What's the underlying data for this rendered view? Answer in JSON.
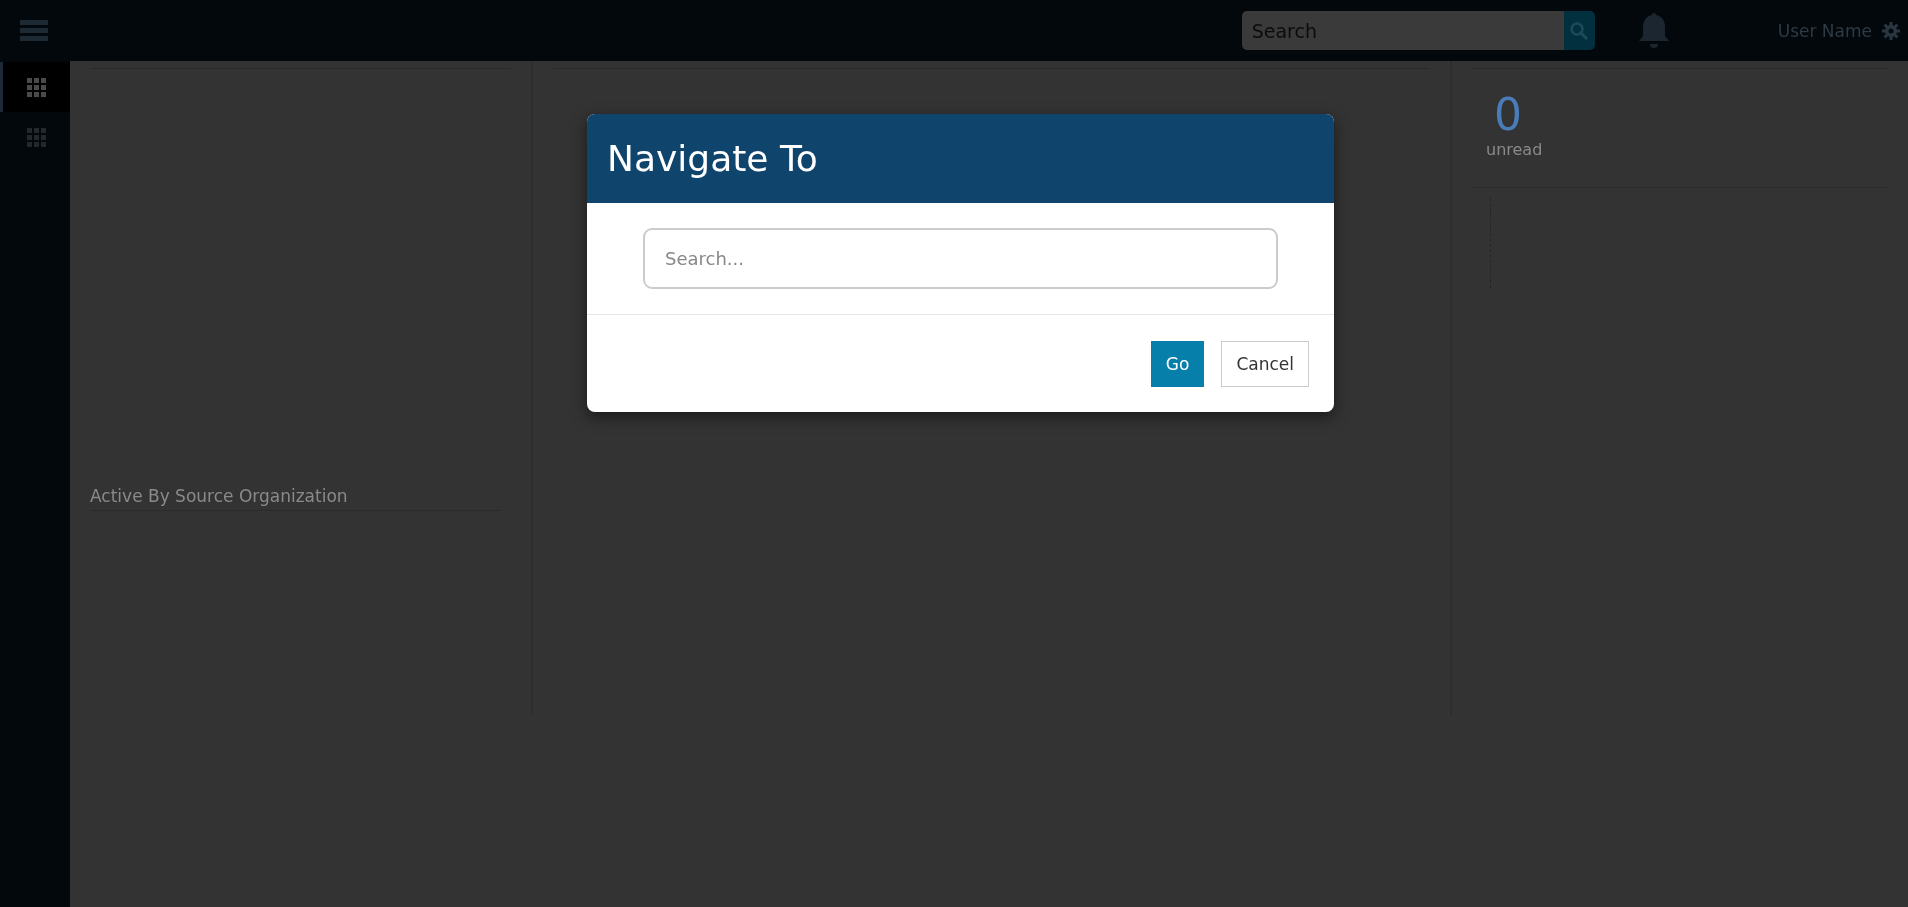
{
  "header": {
    "search": {
      "placeholder": "Search"
    },
    "user_name": "User Name"
  },
  "sidebar": {
    "items": [
      {
        "selected": true
      },
      {
        "selected": false
      }
    ]
  },
  "left_panel": {
    "heading": "Active By Source Organization"
  },
  "right_panel": {
    "count": "0",
    "label": "unread"
  },
  "dialog": {
    "title": "Navigate To",
    "search": {
      "placeholder": "Search..."
    },
    "buttons": [
      {
        "label": "Go",
        "kind": "primary"
      },
      {
        "label": "Cancel",
        "kind": "secondary"
      }
    ]
  }
}
